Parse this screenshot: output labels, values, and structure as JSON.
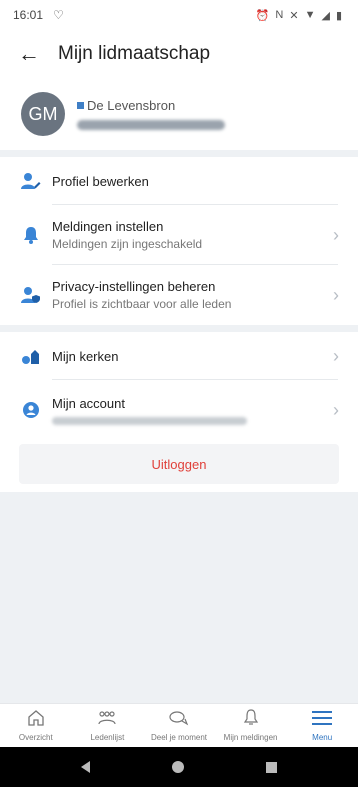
{
  "status": {
    "time": "16:01"
  },
  "appbar": {
    "title": "Mijn lidmaatschap"
  },
  "profile": {
    "initials": "GM",
    "org": "De Levensbron",
    "name_blurred": true
  },
  "section1": [
    {
      "label": "Profiel bewerken",
      "icon": "user-edit-icon"
    },
    {
      "label": "Meldingen instellen",
      "sub": "Meldingen zijn ingeschakeld",
      "icon": "bell-icon"
    },
    {
      "label": "Privacy-instellingen beheren",
      "sub": "Profiel is zichtbaar voor alle leden",
      "icon": "user-shield-icon"
    }
  ],
  "section2": [
    {
      "label": "Mijn kerken",
      "icon": "church-icon"
    },
    {
      "label": "Mijn account",
      "icon": "account-icon",
      "sub_blurred": true
    }
  ],
  "logout": {
    "label": "Uitloggen"
  },
  "bottom_nav": [
    {
      "label": "Overzicht",
      "icon": "home-icon"
    },
    {
      "label": "Ledenlijst",
      "icon": "members-icon"
    },
    {
      "label": "Deel je moment",
      "icon": "chat-icon"
    },
    {
      "label": "Mijn meldingen",
      "icon": "bell-icon"
    },
    {
      "label": "Menu",
      "icon": "menu-icon",
      "active": true
    }
  ],
  "colors": {
    "accent": "#2f74c0",
    "danger": "#e0403a",
    "background": "#eef1f4"
  }
}
